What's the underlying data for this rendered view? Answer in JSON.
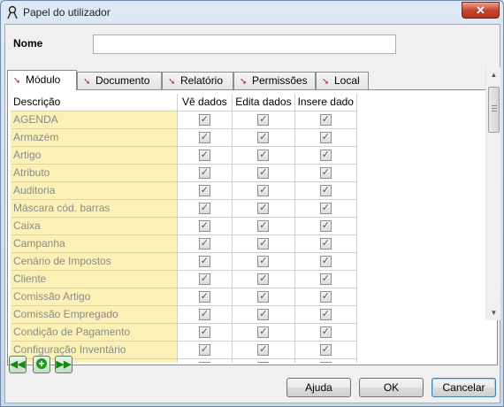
{
  "window": {
    "title": "Papel do utilizador",
    "close_label": "✕"
  },
  "name_label": "Nome",
  "name_value": "",
  "tabs": [
    {
      "label": "Módulo",
      "active": true
    },
    {
      "label": "Documento",
      "active": false
    },
    {
      "label": "Relatório",
      "active": false
    },
    {
      "label": "Permissões",
      "active": false
    },
    {
      "label": "Local",
      "active": false
    }
  ],
  "table": {
    "columns": [
      "Descrição",
      "Vê dados",
      "Edita dados",
      "Insere dado"
    ],
    "rows": [
      {
        "desc": "AGENDA",
        "ve": true,
        "edita": true,
        "insere": true
      },
      {
        "desc": "Armazém",
        "ve": true,
        "edita": true,
        "insere": true
      },
      {
        "desc": "Artigo",
        "ve": true,
        "edita": true,
        "insere": true
      },
      {
        "desc": "Atributo",
        "ve": true,
        "edita": true,
        "insere": true
      },
      {
        "desc": "Auditoria",
        "ve": true,
        "edita": true,
        "insere": true
      },
      {
        "desc": "Máscara cód. barras",
        "ve": true,
        "edita": true,
        "insere": true
      },
      {
        "desc": "Caixa",
        "ve": true,
        "edita": true,
        "insere": true
      },
      {
        "desc": "Campanha",
        "ve": true,
        "edita": true,
        "insere": true
      },
      {
        "desc": "Cenário de Impostos",
        "ve": true,
        "edita": true,
        "insere": true
      },
      {
        "desc": "Cliente",
        "ve": true,
        "edita": true,
        "insere": true
      },
      {
        "desc": "Comissão Artigo",
        "ve": true,
        "edita": true,
        "insere": true
      },
      {
        "desc": "Comissão Empregado",
        "ve": true,
        "edita": true,
        "insere": true
      },
      {
        "desc": "Condição de Pagamento",
        "ve": true,
        "edita": true,
        "insere": true
      },
      {
        "desc": "Configuração Inventário",
        "ve": true,
        "edita": true,
        "insere": true
      },
      {
        "desc": "Configuração de Documento",
        "ve": true,
        "edita": true,
        "insere": true
      }
    ]
  },
  "buttons": {
    "ajuda": "Ajuda",
    "ok": "OK",
    "cancelar": "Cancelar"
  },
  "icons": {
    "checkbox": "checkmark-icon",
    "nav_first": "double-left-arrow-icon",
    "nav_add": "plus-icon",
    "nav_next": "double-right-arrow-icon"
  }
}
